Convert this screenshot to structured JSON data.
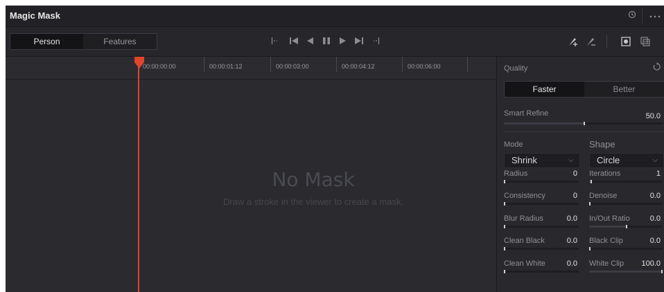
{
  "title_bar": {
    "title": "Magic Mask",
    "icons": [
      "history-icon",
      "more-options-icon"
    ]
  },
  "toolbar": {
    "tabs": [
      {
        "label": "Person",
        "active": true
      },
      {
        "label": "Features",
        "active": false
      }
    ],
    "transport": [
      "track-in-icon",
      "previous-frame-icon",
      "track-backward-icon",
      "pause-icon",
      "track-forward-icon",
      "next-frame-icon",
      "track-out-icon"
    ],
    "tools": [
      "add-stroke-icon",
      "subtract-stroke-icon",
      "mask-overlay-icon",
      "toggle-overlay-icon"
    ]
  },
  "timeline": {
    "timecodes": [
      "00:00:00:00",
      "00:00:01:12",
      "00:00:03:00",
      "00:00:04:12",
      "00:00:06:00"
    ],
    "empty_title": "No Mask",
    "empty_subtitle": "Draw a stroke in the viewer to create a mask."
  },
  "inspector": {
    "quality": {
      "label": "Quality",
      "options": [
        {
          "label": "Faster",
          "active": true
        },
        {
          "label": "Better",
          "active": false
        }
      ]
    },
    "smart_refine": {
      "label": "Smart Refine",
      "value": "50.0",
      "level": 0.5
    },
    "mode": {
      "label": "Mode",
      "selected": "Shrink"
    },
    "shape": {
      "label": "Shape",
      "selected": "Circle"
    },
    "left_params": [
      {
        "label": "Radius",
        "value": "0",
        "level": 0
      },
      {
        "label": "Consistency",
        "value": "0",
        "level": 0
      },
      {
        "label": "Blur Radius",
        "value": "0.0",
        "level": 0
      },
      {
        "label": "Clean Black",
        "value": "0.0",
        "level": 0
      },
      {
        "label": "Clean White",
        "value": "0.0",
        "level": 0
      }
    ],
    "right_params": [
      {
        "label": "Iterations",
        "value": "1",
        "level": 0.02
      },
      {
        "label": "Denoise",
        "value": "0.0",
        "level": 0
      },
      {
        "label": "In/Out Ratio",
        "value": "0.0",
        "level": 0.5
      },
      {
        "label": "Black Clip",
        "value": "0.0",
        "level": 0
      },
      {
        "label": "White Clip",
        "value": "100.0",
        "level": 1.0
      }
    ]
  },
  "colors": {
    "playhead": "#e0452c",
    "panel_bg": "#28282e",
    "text": "#e4e4e8"
  }
}
